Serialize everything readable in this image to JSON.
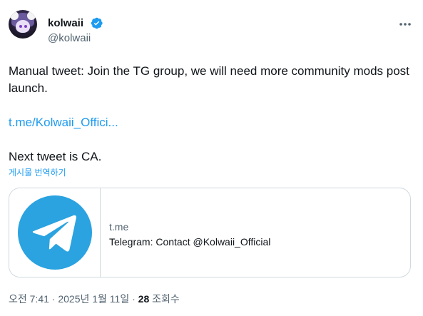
{
  "author": {
    "display_name": "kolwaii",
    "handle": "@kolwaii"
  },
  "tweet": {
    "line1": "Manual tweet: Join the TG group, we will need more community mods post launch.",
    "link": "t.me/Kolwaii_Offici...",
    "line3": "Next tweet is CA.",
    "translate_label": "게시물 번역하기"
  },
  "card": {
    "domain": "t.me",
    "title": "Telegram: Contact @Kolwaii_Official"
  },
  "meta": {
    "timestamp": "오전 7:41 · 2025년 1월 11일 · ",
    "view_count": "28",
    "view_label": " 조회수"
  },
  "colors": {
    "accent": "#1d9bf0",
    "telegram": "#2aa3e0",
    "text": "#0f1419",
    "secondary": "#536471",
    "border": "#cfd9de"
  },
  "icons": {
    "verified": "verified-badge-icon",
    "more": "more-horizontal-icon",
    "telegram": "telegram-logo-icon"
  }
}
